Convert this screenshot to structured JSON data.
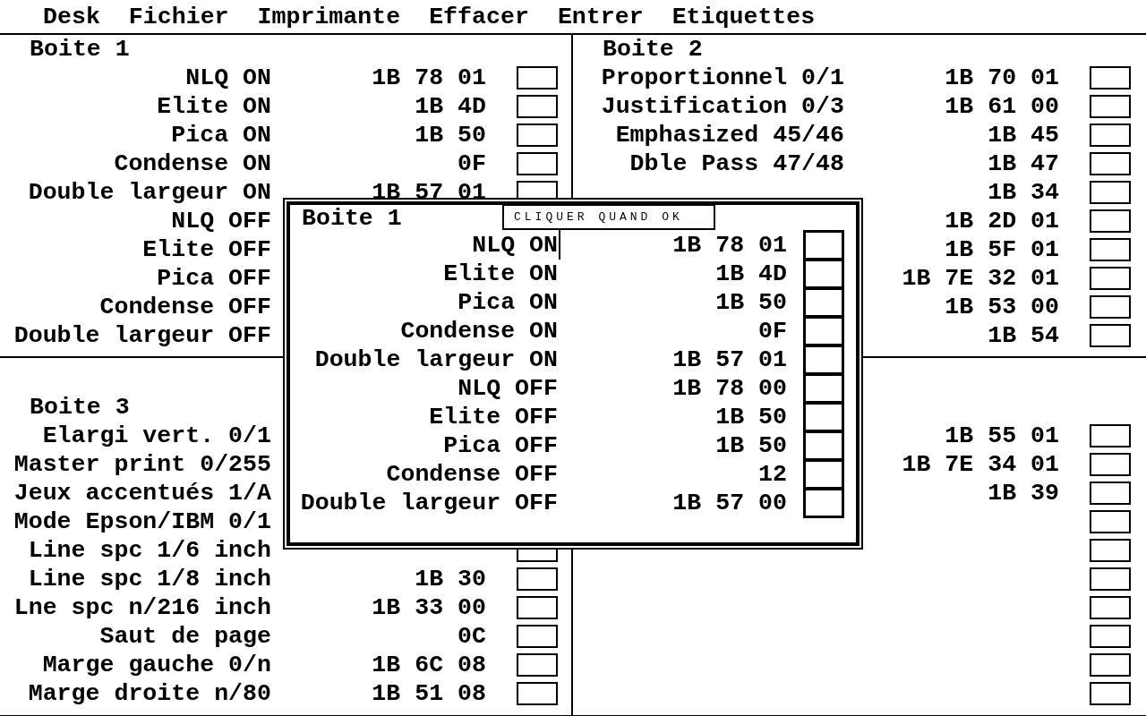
{
  "menu": [
    {
      "label": "Desk"
    },
    {
      "label": "Fichier"
    },
    {
      "label": "Imprimante"
    },
    {
      "label": "Effacer"
    },
    {
      "label": "Entrer"
    },
    {
      "label": "Etiquettes"
    }
  ],
  "boxes": [
    {
      "title": "Boite 1",
      "rows": [
        {
          "label": "NLQ ON",
          "code": "1B 78 01",
          "checked": false
        },
        {
          "label": "Elite ON",
          "code": "1B 4D",
          "checked": false
        },
        {
          "label": "Pica ON",
          "code": "1B 50",
          "checked": false
        },
        {
          "label": "Condense ON",
          "code": "0F",
          "checked": false
        },
        {
          "label": "Double largeur ON",
          "code": "1B 57 01",
          "checked": false
        },
        {
          "label": "NLQ OFF"
        },
        {
          "label": "Elite OFF"
        },
        {
          "label": "Pica OFF"
        },
        {
          "label": "Condense OFF"
        },
        {
          "label": "Double largeur OFF"
        }
      ]
    },
    {
      "title": "Boite 2",
      "rows": [
        {
          "label": "Proportionnel 0/1",
          "code": "1B 70 01",
          "checked": false
        },
        {
          "label": "Justification 0/3",
          "code": "1B 61 00",
          "checked": false
        },
        {
          "label": "Emphasized 45/46",
          "code": "1B 45",
          "checked": false
        },
        {
          "label": "Dble Pass 47/48",
          "code": "1B 47",
          "checked": false
        },
        {
          "code": "1B 34",
          "checked": false
        },
        {
          "code": "1B 2D 01",
          "checked": false
        },
        {
          "code": "1B 5F 01",
          "checked": false
        },
        {
          "code": "1B 7E 32 01",
          "checked": false
        },
        {
          "code": "1B 53 00",
          "checked": false
        },
        {
          "code": "1B 54",
          "checked": false
        }
      ]
    },
    {
      "title": "Boite 3",
      "rows": [
        {
          "label": "Elargi vert. 0/1"
        },
        {
          "label": "Master print 0/255"
        },
        {
          "label": "Jeux accentués 1/A"
        },
        {
          "label": "Mode Epson/IBM 0/1"
        },
        {
          "label": "Line spc 1/6 inch",
          "checked": false
        },
        {
          "label": "Line spc 1/8 inch",
          "code": "1B 30",
          "checked": false
        },
        {
          "label": "Lne spc n/216 inch",
          "code": "1B 33 00",
          "checked": false
        },
        {
          "label": "Saut de page",
          "code": "0C",
          "checked": false
        },
        {
          "label": "Marge gauche 0/n",
          "code": "1B 6C 08",
          "checked": false
        },
        {
          "label": "Marge droite n/80",
          "code": "1B 51 08",
          "checked": false
        }
      ]
    },
    {
      "rows": [
        {
          "code": "1B 55 01",
          "checked": false
        },
        {
          "code": "1B 7E 34 01",
          "checked": false
        },
        {
          "code": "1B 39",
          "checked": false
        },
        {
          "checked": false
        },
        {
          "checked": false
        },
        {
          "checked": false
        },
        {
          "checked": false
        },
        {
          "checked": false
        },
        {
          "checked": false
        },
        {
          "checked": false
        }
      ]
    }
  ],
  "dialog": {
    "title": "Boite 1",
    "button": "CLIQUER QUAND OK",
    "rows": [
      {
        "label": "NLQ ON",
        "code": "1B 78 01",
        "checked": false
      },
      {
        "label": "Elite ON",
        "code": "1B 4D",
        "checked": false
      },
      {
        "label": "Pica ON",
        "code": "1B 50",
        "checked": false
      },
      {
        "label": "Condense ON",
        "code": "0F",
        "checked": false
      },
      {
        "label": "Double largeur ON",
        "code": "1B 57 01",
        "checked": false
      },
      {
        "label": "NLQ OFF",
        "code": "1B 78 00",
        "checked": false
      },
      {
        "label": "Elite OFF",
        "code": "1B 50",
        "checked": false
      },
      {
        "label": "Pica OFF",
        "code": "1B 50",
        "checked": false
      },
      {
        "label": "Condense OFF",
        "code": "12",
        "checked": false
      },
      {
        "label": "Double largeur OFF",
        "code": "1B 57 00",
        "checked": false
      }
    ]
  }
}
